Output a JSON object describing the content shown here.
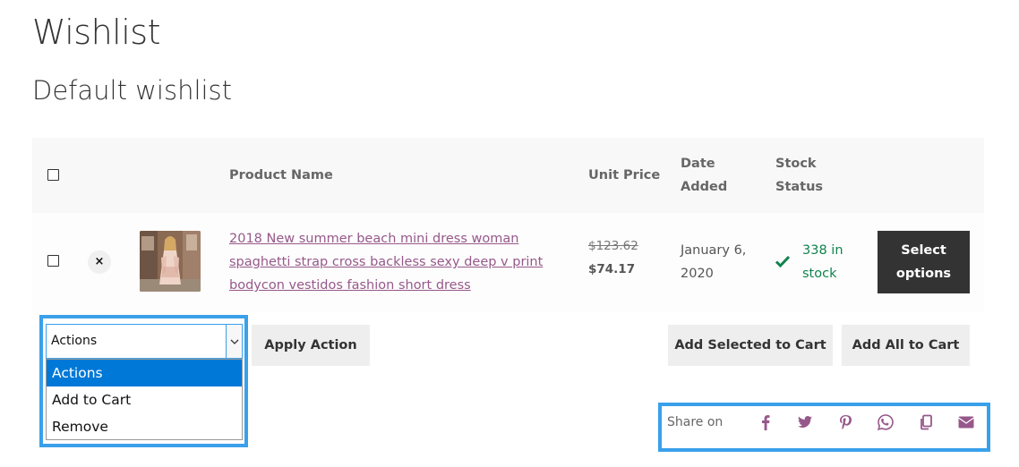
{
  "page": {
    "title": "Wishlist",
    "wishlist_name": "Default wishlist"
  },
  "table": {
    "headers": {
      "product_name": "Product Name",
      "unit_price": "Unit Price",
      "date_added": "Date Added",
      "stock_status": "Stock Status"
    },
    "rows": [
      {
        "remove_glyph": "×",
        "product_name": "2018 New summer beach mini dress woman spaghetti strap cross backless sexy deep v print bodycon vestidos fashion short dress",
        "old_price": "$123.62",
        "new_price": "$74.17",
        "date_added": "January 6, 2020",
        "stock": "338 in stock",
        "action_label": "Select options"
      }
    ]
  },
  "actions": {
    "select_value": "Actions",
    "options": [
      "Actions",
      "Add to Cart",
      "Remove"
    ],
    "apply_label": "Apply Action",
    "add_selected_label": "Add Selected to Cart",
    "add_all_label": "Add All to Cart"
  },
  "share": {
    "label": "Share on",
    "icons": [
      "facebook-icon",
      "twitter-icon",
      "pinterest-icon",
      "whatsapp-icon",
      "copy-link-icon",
      "email-icon"
    ],
    "icon_color": "#96588a"
  },
  "colors": {
    "link": "#96588a",
    "in_stock": "#0f834d",
    "primary_button": "#333333",
    "highlight_frame": "#3aa0ea",
    "dropdown_selected": "#0078d7"
  }
}
